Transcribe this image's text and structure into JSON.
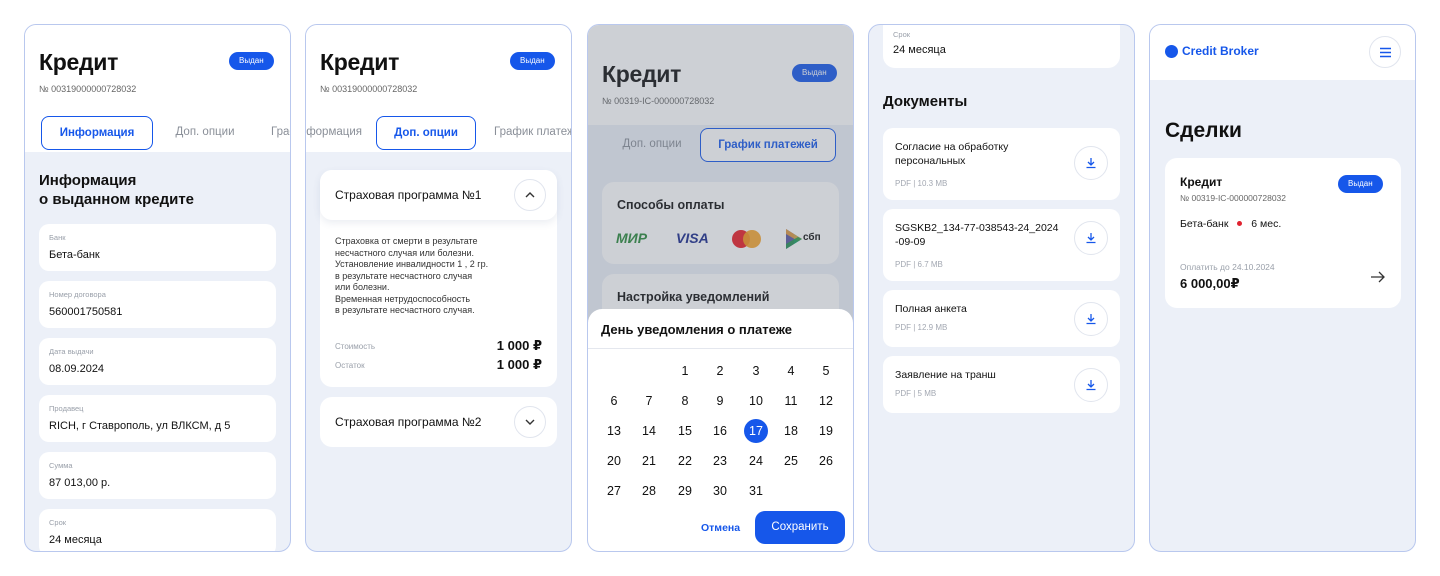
{
  "screen1": {
    "title": "Кредит",
    "number": "№ 00319000000728032",
    "status": "Выдан",
    "tabs": [
      "Информация",
      "Доп. опции",
      "График платежей"
    ],
    "section_title_line1": "Информация",
    "section_title_line2": "о выданном кредите",
    "fields": [
      {
        "label": "Банк",
        "value": "Бета-банк"
      },
      {
        "label": "Номер договора",
        "value": "560001750581"
      },
      {
        "label": "Дата выдачи",
        "value": "08.09.2024"
      },
      {
        "label": "Продавец",
        "value": "RICH, г Ставрополь, ул ВЛКСМ, д 5"
      },
      {
        "label": "Сумма",
        "value": "87 013,00 р."
      },
      {
        "label": "Срок",
        "value": "24 месяца"
      }
    ]
  },
  "screen2": {
    "title": "Кредит",
    "number": "№ 00319000000728032",
    "status": "Выдан",
    "tabs": [
      "Информация",
      "Доп. опции",
      "График платежей"
    ],
    "program1": {
      "title": "Страховая программа №1",
      "description": "Страховка от смерти в результате\nнесчастного случая или болезни.\nУстановление инвалидности 1 , 2 гр.\nв результате несчастного случая\nили болезни.\nВременная нетрудоспособность\nв результате несчастного случая.",
      "cost_label": "Стоимость",
      "cost_value": "1 000 ₽",
      "remainder_label": "Остаток",
      "remainder_value": "1 000 ₽"
    },
    "program2": {
      "title": "Страховая программа №2"
    }
  },
  "screen3": {
    "title": "Кредит",
    "number": "№ 00319-IC-000000728032",
    "status": "Выдан",
    "tabs": [
      "Доп. опции",
      "График платежей"
    ],
    "payment_methods_title": "Способы оплаты",
    "payment_methods": [
      "МИР",
      "VISA",
      "mastercard",
      "сбп"
    ],
    "notifications_title": "Настройка уведомлений",
    "sheet_title": "День уведомления о платеже",
    "days": [
      1,
      2,
      3,
      4,
      5,
      6,
      7,
      8,
      9,
      10,
      11,
      12,
      13,
      14,
      15,
      16,
      17,
      18,
      19,
      20,
      21,
      22,
      23,
      24,
      25,
      26,
      27,
      28,
      29,
      30,
      31
    ],
    "selected_day": 17,
    "cancel_label": "Отмена",
    "save_label": "Сохранить"
  },
  "screen4": {
    "term_label": "Срок",
    "term_value": "24 месяца",
    "documents_title": "Документы",
    "documents": [
      {
        "name": "Согласие на обработку персональных",
        "format": "PDF",
        "size": "10.3 MB"
      },
      {
        "name": "SGSKB2_134-77-038543-24_2024 -09-09",
        "format": "PDF",
        "size": "6.7 MB"
      },
      {
        "name": "Полная анкета",
        "format": "PDF",
        "size": "12.9 MB"
      },
      {
        "name": "Заявление на транш",
        "format": "PDF",
        "size": "5 MB"
      }
    ]
  },
  "screen5": {
    "brand": "Credit Broker",
    "page_title": "Сделки",
    "deal": {
      "title": "Кредит",
      "number": "№ 00319-IC-000000728032",
      "status": "Выдан",
      "bank": "Бета-банк",
      "term": "6 мес.",
      "due_label": "Оплатить до 24.10.2024",
      "amount": "6 000,00₽"
    }
  },
  "colors": {
    "accent": "#1657ea",
    "background": "#ecf0f8",
    "dot_red": "#e0222f"
  },
  "icons": {
    "chevron_up": "chevron-up-icon",
    "chevron_down": "chevron-down-icon",
    "download": "download-icon",
    "menu": "hamburger-menu-icon",
    "arrow_right": "arrow-right-icon"
  }
}
